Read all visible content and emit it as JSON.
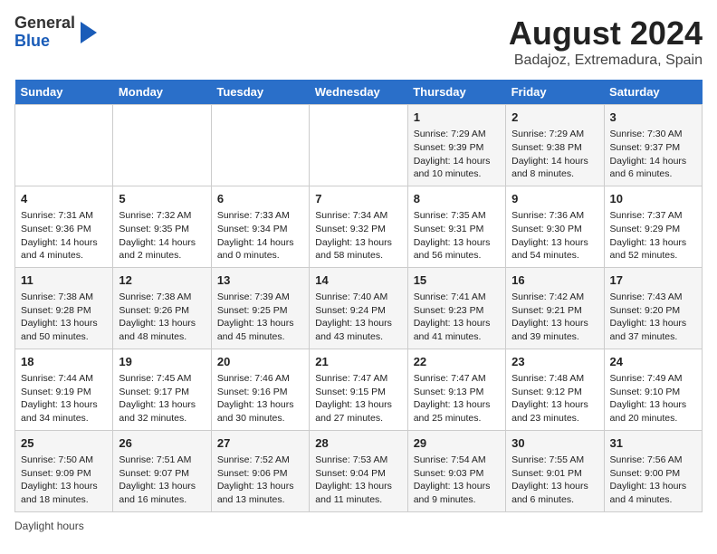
{
  "header": {
    "logo_line1": "General",
    "logo_line2": "Blue",
    "title": "August 2024",
    "subtitle": "Badajoz, Extremadura, Spain"
  },
  "footer": {
    "daylight_label": "Daylight hours"
  },
  "columns": [
    "Sunday",
    "Monday",
    "Tuesday",
    "Wednesday",
    "Thursday",
    "Friday",
    "Saturday"
  ],
  "weeks": [
    [
      {
        "day": "",
        "info": ""
      },
      {
        "day": "",
        "info": ""
      },
      {
        "day": "",
        "info": ""
      },
      {
        "day": "",
        "info": ""
      },
      {
        "day": "1",
        "info": "Sunrise: 7:29 AM\nSunset: 9:39 PM\nDaylight: 14 hours and 10 minutes."
      },
      {
        "day": "2",
        "info": "Sunrise: 7:29 AM\nSunset: 9:38 PM\nDaylight: 14 hours and 8 minutes."
      },
      {
        "day": "3",
        "info": "Sunrise: 7:30 AM\nSunset: 9:37 PM\nDaylight: 14 hours and 6 minutes."
      }
    ],
    [
      {
        "day": "4",
        "info": "Sunrise: 7:31 AM\nSunset: 9:36 PM\nDaylight: 14 hours and 4 minutes."
      },
      {
        "day": "5",
        "info": "Sunrise: 7:32 AM\nSunset: 9:35 PM\nDaylight: 14 hours and 2 minutes."
      },
      {
        "day": "6",
        "info": "Sunrise: 7:33 AM\nSunset: 9:34 PM\nDaylight: 14 hours and 0 minutes."
      },
      {
        "day": "7",
        "info": "Sunrise: 7:34 AM\nSunset: 9:32 PM\nDaylight: 13 hours and 58 minutes."
      },
      {
        "day": "8",
        "info": "Sunrise: 7:35 AM\nSunset: 9:31 PM\nDaylight: 13 hours and 56 minutes."
      },
      {
        "day": "9",
        "info": "Sunrise: 7:36 AM\nSunset: 9:30 PM\nDaylight: 13 hours and 54 minutes."
      },
      {
        "day": "10",
        "info": "Sunrise: 7:37 AM\nSunset: 9:29 PM\nDaylight: 13 hours and 52 minutes."
      }
    ],
    [
      {
        "day": "11",
        "info": "Sunrise: 7:38 AM\nSunset: 9:28 PM\nDaylight: 13 hours and 50 minutes."
      },
      {
        "day": "12",
        "info": "Sunrise: 7:38 AM\nSunset: 9:26 PM\nDaylight: 13 hours and 48 minutes."
      },
      {
        "day": "13",
        "info": "Sunrise: 7:39 AM\nSunset: 9:25 PM\nDaylight: 13 hours and 45 minutes."
      },
      {
        "day": "14",
        "info": "Sunrise: 7:40 AM\nSunset: 9:24 PM\nDaylight: 13 hours and 43 minutes."
      },
      {
        "day": "15",
        "info": "Sunrise: 7:41 AM\nSunset: 9:23 PM\nDaylight: 13 hours and 41 minutes."
      },
      {
        "day": "16",
        "info": "Sunrise: 7:42 AM\nSunset: 9:21 PM\nDaylight: 13 hours and 39 minutes."
      },
      {
        "day": "17",
        "info": "Sunrise: 7:43 AM\nSunset: 9:20 PM\nDaylight: 13 hours and 37 minutes."
      }
    ],
    [
      {
        "day": "18",
        "info": "Sunrise: 7:44 AM\nSunset: 9:19 PM\nDaylight: 13 hours and 34 minutes."
      },
      {
        "day": "19",
        "info": "Sunrise: 7:45 AM\nSunset: 9:17 PM\nDaylight: 13 hours and 32 minutes."
      },
      {
        "day": "20",
        "info": "Sunrise: 7:46 AM\nSunset: 9:16 PM\nDaylight: 13 hours and 30 minutes."
      },
      {
        "day": "21",
        "info": "Sunrise: 7:47 AM\nSunset: 9:15 PM\nDaylight: 13 hours and 27 minutes."
      },
      {
        "day": "22",
        "info": "Sunrise: 7:47 AM\nSunset: 9:13 PM\nDaylight: 13 hours and 25 minutes."
      },
      {
        "day": "23",
        "info": "Sunrise: 7:48 AM\nSunset: 9:12 PM\nDaylight: 13 hours and 23 minutes."
      },
      {
        "day": "24",
        "info": "Sunrise: 7:49 AM\nSunset: 9:10 PM\nDaylight: 13 hours and 20 minutes."
      }
    ],
    [
      {
        "day": "25",
        "info": "Sunrise: 7:50 AM\nSunset: 9:09 PM\nDaylight: 13 hours and 18 minutes."
      },
      {
        "day": "26",
        "info": "Sunrise: 7:51 AM\nSunset: 9:07 PM\nDaylight: 13 hours and 16 minutes."
      },
      {
        "day": "27",
        "info": "Sunrise: 7:52 AM\nSunset: 9:06 PM\nDaylight: 13 hours and 13 minutes."
      },
      {
        "day": "28",
        "info": "Sunrise: 7:53 AM\nSunset: 9:04 PM\nDaylight: 13 hours and 11 minutes."
      },
      {
        "day": "29",
        "info": "Sunrise: 7:54 AM\nSunset: 9:03 PM\nDaylight: 13 hours and 9 minutes."
      },
      {
        "day": "30",
        "info": "Sunrise: 7:55 AM\nSunset: 9:01 PM\nDaylight: 13 hours and 6 minutes."
      },
      {
        "day": "31",
        "info": "Sunrise: 7:56 AM\nSunset: 9:00 PM\nDaylight: 13 hours and 4 minutes."
      }
    ]
  ]
}
